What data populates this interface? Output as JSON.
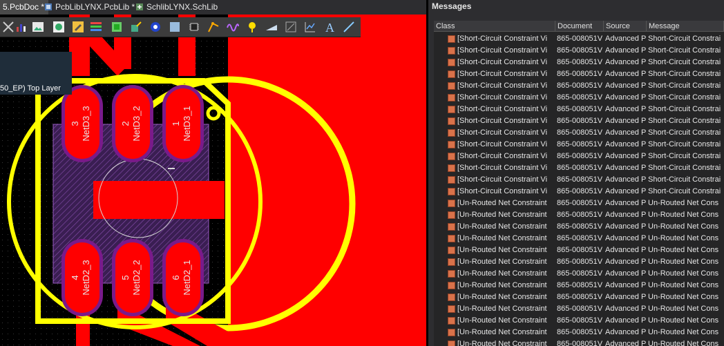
{
  "tabs": [
    {
      "label": "5.PcbDoc *",
      "active": true,
      "icon": "pcb-doc-icon"
    },
    {
      "label": "PcbLibLYNX.PcbLib *",
      "active": false,
      "icon": "pcb-lib-icon"
    },
    {
      "label": "SchlibLYNX.SchLib",
      "active": false,
      "icon": "sch-lib-icon"
    }
  ],
  "canvas": {
    "layer_label": "50_EP)  Top Layer",
    "colors": {
      "copper": "#ff0000",
      "overlay": "#ffff00",
      "pad_outline": "#7a1a8a",
      "hatch": "#6b3a8c",
      "circle": "#e0e0e0"
    },
    "pads": [
      {
        "number": "3",
        "net": "NetD3_3"
      },
      {
        "number": "2",
        "net": "NetD3_2"
      },
      {
        "number": "1",
        "net": "NetD3_1"
      },
      {
        "number": "4",
        "net": "NetD2_3"
      },
      {
        "number": "5",
        "net": "NetD2_2"
      },
      {
        "number": "6",
        "net": "NetD2_1"
      }
    ]
  },
  "toolbar": {
    "icons": [
      "interactive-route-icon",
      "bar-chart-icon",
      "image-icon",
      "component-icon",
      "edit-icon",
      "layers-icon",
      "place-pad-icon",
      "place-via-icon",
      "place-fill-icon",
      "place-region-icon",
      "chip-icon",
      "route-icon",
      "wave-icon",
      "pin-icon",
      "dimension-icon",
      "polygon-icon",
      "graph-icon",
      "text-icon",
      "line-icon"
    ]
  },
  "messages": {
    "title": "Messages",
    "columns": [
      "Class",
      "Document",
      "Source",
      "Message"
    ],
    "rows": [
      [
        "[Short-Circuit Constraint Vi",
        "865-008051V",
        "Advanced P",
        "Short-Circuit Constrai"
      ],
      [
        "[Short-Circuit Constraint Vi",
        "865-008051V",
        "Advanced P",
        "Short-Circuit Constrai"
      ],
      [
        "[Short-Circuit Constraint Vi",
        "865-008051V",
        "Advanced P",
        "Short-Circuit Constrai"
      ],
      [
        "[Short-Circuit Constraint Vi",
        "865-008051V",
        "Advanced P",
        "Short-Circuit Constrai"
      ],
      [
        "[Short-Circuit Constraint Vi",
        "865-008051V",
        "Advanced P",
        "Short-Circuit Constrai"
      ],
      [
        "[Short-Circuit Constraint Vi",
        "865-008051V",
        "Advanced P",
        "Short-Circuit Constrai"
      ],
      [
        "[Short-Circuit Constraint Vi",
        "865-008051V",
        "Advanced P",
        "Short-Circuit Constrai"
      ],
      [
        "[Short-Circuit Constraint Vi",
        "865-008051V",
        "Advanced P",
        "Short-Circuit Constrai"
      ],
      [
        "[Short-Circuit Constraint Vi",
        "865-008051V",
        "Advanced P",
        "Short-Circuit Constrai"
      ],
      [
        "[Short-Circuit Constraint Vi",
        "865-008051V",
        "Advanced P",
        "Short-Circuit Constrai"
      ],
      [
        "[Short-Circuit Constraint Vi",
        "865-008051V",
        "Advanced P",
        "Short-Circuit Constrai"
      ],
      [
        "[Short-Circuit Constraint Vi",
        "865-008051V",
        "Advanced P",
        "Short-Circuit Constrai"
      ],
      [
        "[Short-Circuit Constraint Vi",
        "865-008051V",
        "Advanced P",
        "Short-Circuit Constrai"
      ],
      [
        "[Short-Circuit Constraint Vi",
        "865-008051V",
        "Advanced P",
        "Short-Circuit Constrai"
      ],
      [
        "[Un-Routed Net Constraint",
        "865-008051V",
        "Advanced P",
        "Un-Routed Net Cons"
      ],
      [
        "[Un-Routed Net Constraint",
        "865-008051V",
        "Advanced P",
        "Un-Routed Net Cons"
      ],
      [
        "[Un-Routed Net Constraint",
        "865-008051V",
        "Advanced P",
        "Un-Routed Net Cons"
      ],
      [
        "[Un-Routed Net Constraint",
        "865-008051V",
        "Advanced P",
        "Un-Routed Net Cons"
      ],
      [
        "[Un-Routed Net Constraint",
        "865-008051V",
        "Advanced P",
        "Un-Routed Net Cons"
      ],
      [
        "[Un-Routed Net Constraint",
        "865-008051V",
        "Advanced P",
        "Un-Routed Net Cons"
      ],
      [
        "[Un-Routed Net Constraint",
        "865-008051V",
        "Advanced P",
        "Un-Routed Net Cons"
      ],
      [
        "[Un-Routed Net Constraint",
        "865-008051V",
        "Advanced P",
        "Un-Routed Net Cons"
      ],
      [
        "[Un-Routed Net Constraint",
        "865-008051V",
        "Advanced P",
        "Un-Routed Net Cons"
      ],
      [
        "[Un-Routed Net Constraint",
        "865-008051V",
        "Advanced P",
        "Un-Routed Net Cons"
      ],
      [
        "[Un-Routed Net Constraint",
        "865-008051V",
        "Advanced P",
        "Un-Routed Net Cons"
      ],
      [
        "[Un-Routed Net Constraint",
        "865-008051V",
        "Advanced P",
        "Un-Routed Net Cons"
      ],
      [
        "[Un-Routed Net Constraint",
        "865-008051V",
        "Advanced P",
        "Un-Routed Net Cons"
      ]
    ]
  }
}
